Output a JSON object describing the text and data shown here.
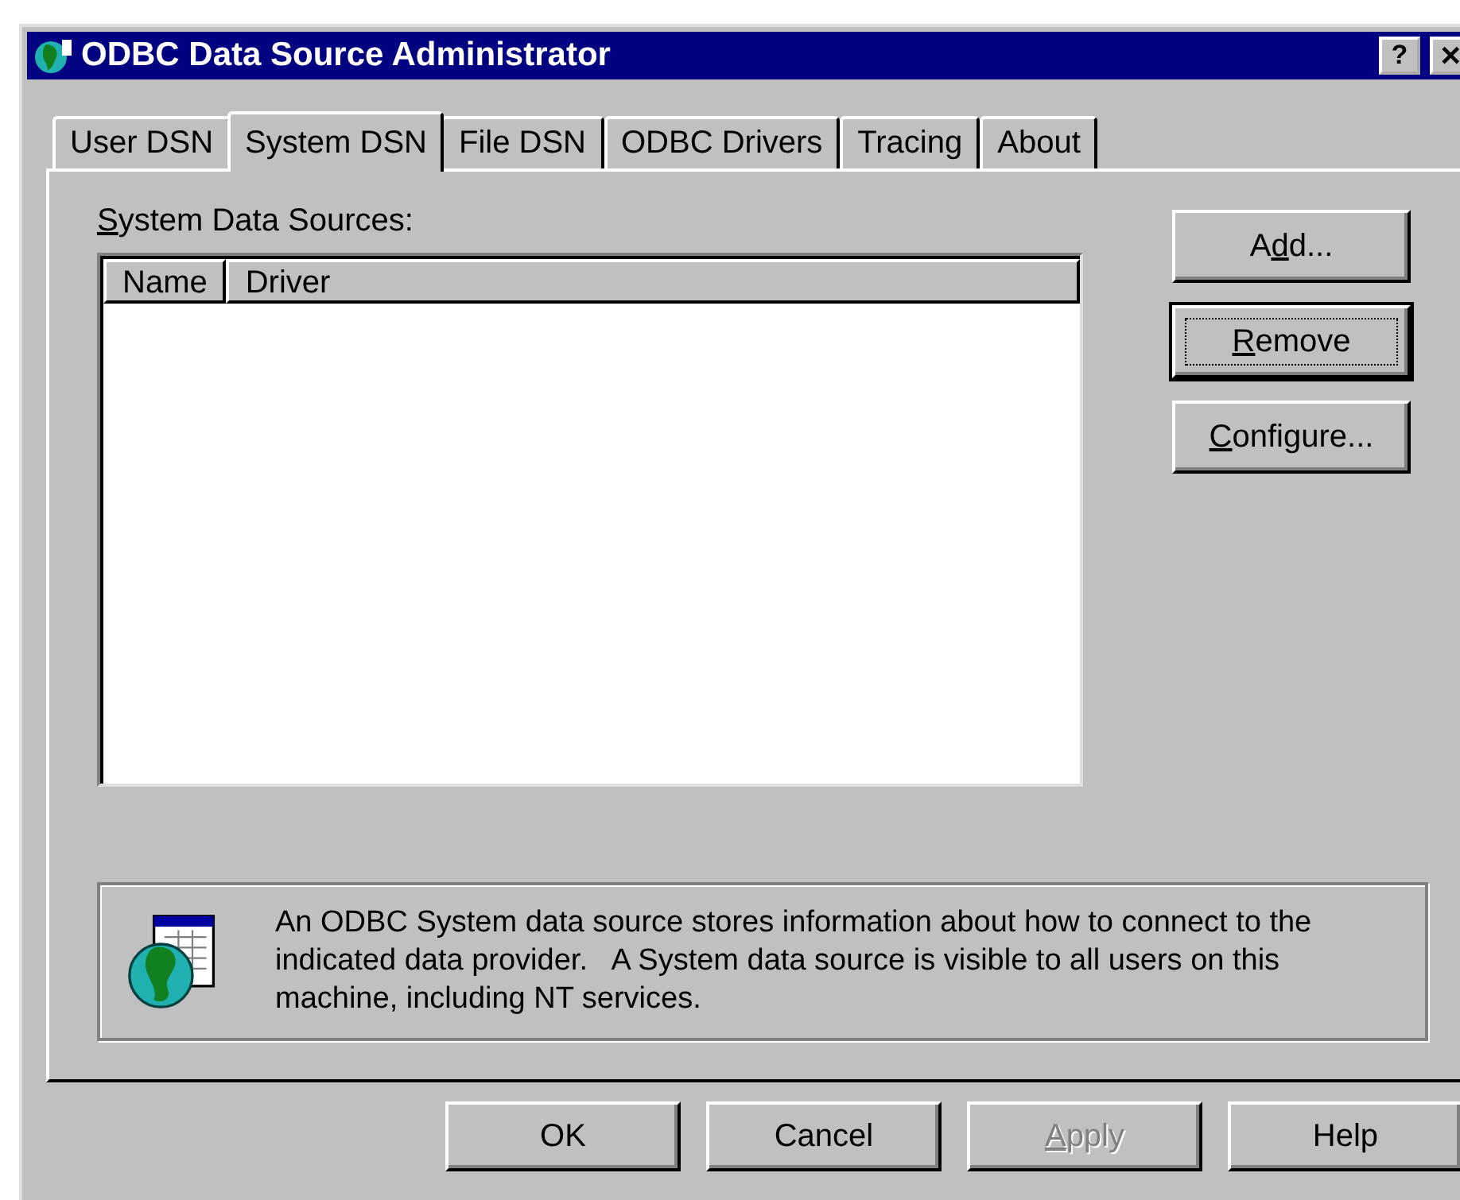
{
  "window": {
    "title": "ODBC Data Source Administrator",
    "title_buttons": [
      "?",
      "✕"
    ]
  },
  "tabs": [
    {
      "label": "User DSN",
      "selected": false
    },
    {
      "label": "System DSN",
      "selected": true
    },
    {
      "label": "File DSN",
      "selected": false
    },
    {
      "label": "ODBC Drivers",
      "selected": false
    },
    {
      "label": "Tracing",
      "selected": false
    },
    {
      "label": "About",
      "selected": false
    }
  ],
  "list": {
    "label": {
      "key": "S",
      "post": "ystem Data Sources:"
    },
    "columns": [
      "Name",
      "Driver"
    ]
  },
  "side_buttons": [
    {
      "label": {
        "pre": "A",
        "key": "d",
        "post": "d..."
      },
      "default": false
    },
    {
      "label": {
        "key": "R",
        "post": "emove"
      },
      "default": true
    },
    {
      "label": {
        "key": "C",
        "post": "onfigure..."
      },
      "default": false
    }
  ],
  "info": "An ODBC System data source stores information about how to connect to the indicated data provider.   A System data source is visible to all users on this machine, including NT services.",
  "buttons": [
    {
      "label": {
        "pre": "OK"
      },
      "disabled": false
    },
    {
      "label": {
        "pre": "Cancel"
      },
      "disabled": false
    },
    {
      "label": {
        "key": "A",
        "post": "pply"
      },
      "disabled": true
    },
    {
      "label": {
        "pre": "Help"
      },
      "disabled": false
    }
  ]
}
